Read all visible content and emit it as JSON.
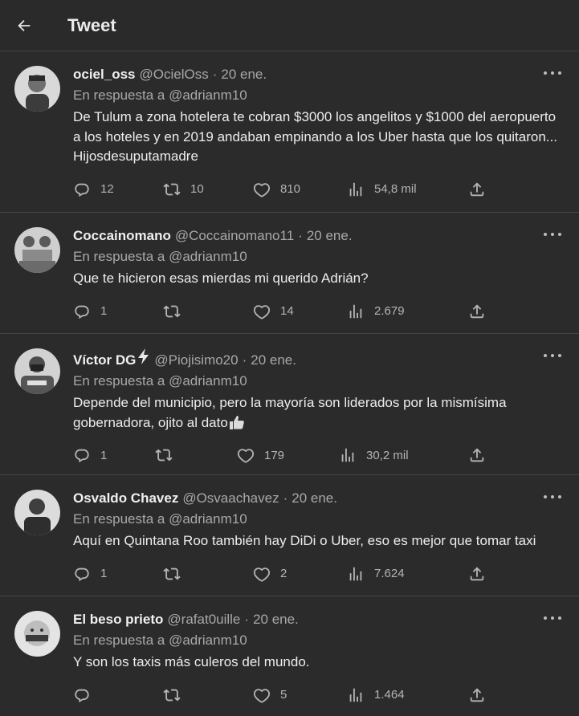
{
  "header": {
    "title": "Tweet",
    "back_icon": "arrow-left-icon"
  },
  "tweets": [
    {
      "name": "ociel_oss",
      "handle": "@OcielOss",
      "separator": "·",
      "date": "20 ene.",
      "reply_to": "En respuesta a @adrianm10",
      "text": "De Tulum a zona hotelera te cobran $3000 los angelitos y $1000 del aeropuerto a los hoteles y en 2019 andaban empinando a los Uber hasta que los quitaron... Hijosdesuputamadre",
      "replies": "12",
      "retweets": "10",
      "likes": "810",
      "views": "54,8 mil"
    },
    {
      "name": "Coccainomano",
      "handle": "@Coccainomano11",
      "separator": "·",
      "date": "20 ene.",
      "reply_to": "En respuesta a @adrianm10",
      "text": "Que te hicieron esas mierdas mi querido Adrián?",
      "replies": "1",
      "retweets": "",
      "likes": "14",
      "views": "2.679"
    },
    {
      "name": "Víctor DG",
      "handle": "@Piojisimo20",
      "separator": "·",
      "date": "20 ene.",
      "reply_to": "En respuesta a @adrianm10",
      "text": "Depende del municipio, pero la mayoría son liderados por la mismísima gobernadora, ojito al dato",
      "replies": "1",
      "retweets": "",
      "likes": "179",
      "views": "30,2 mil"
    },
    {
      "name": "Osvaldo Chavez",
      "handle": "@Osvaachavez",
      "separator": "·",
      "date": "20 ene.",
      "reply_to": "En respuesta a @adrianm10",
      "text": "Aquí en Quintana Roo también hay DiDi o Uber, eso es mejor que tomar taxi",
      "replies": "1",
      "retweets": "",
      "likes": "2",
      "views": "7.624"
    },
    {
      "name": "El beso prieto",
      "handle": "@rafat0uille",
      "separator": "·",
      "date": "20 ene.",
      "reply_to": "En respuesta a @adrianm10",
      "text": "Y son los taxis más culeros del mundo.",
      "replies": "",
      "retweets": "",
      "likes": "5",
      "views": "1.464"
    }
  ]
}
